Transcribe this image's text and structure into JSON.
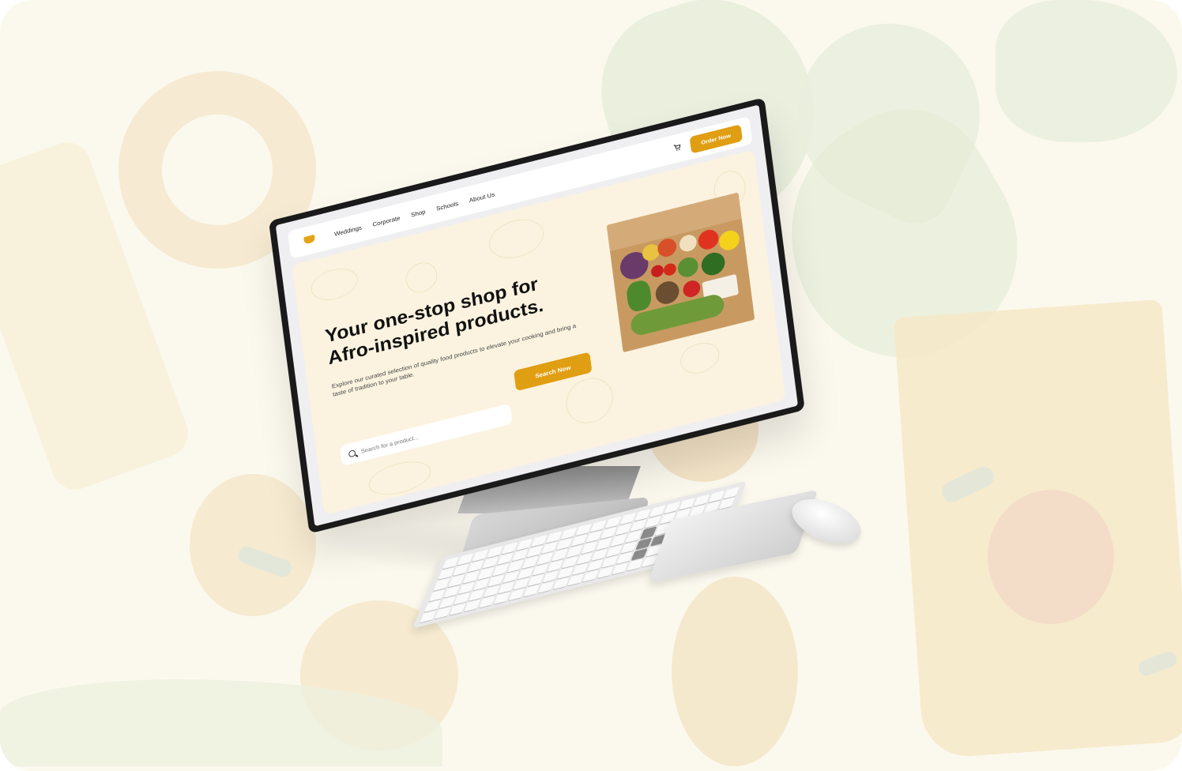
{
  "nav": {
    "links": [
      "Weddings",
      "Corporate",
      "Shop",
      "Schools",
      "About Us"
    ],
    "order_button": "Order Now",
    "cart_icon": "cart-icon",
    "logo_icon": "brand-logo"
  },
  "hero": {
    "headline_line1": "Your one-stop shop for",
    "headline_line2": "Afro-inspired products.",
    "subtext": "Explore our curated selection of quality food products to elevate your cooking and bring a taste of tradition to your table.",
    "search_button": "Search Now",
    "search_placeholder": "Search for a product..."
  },
  "colors": {
    "accent": "#e09e12",
    "hero_bg": "#fbf3df",
    "page_bg": "#fbf9ee"
  }
}
